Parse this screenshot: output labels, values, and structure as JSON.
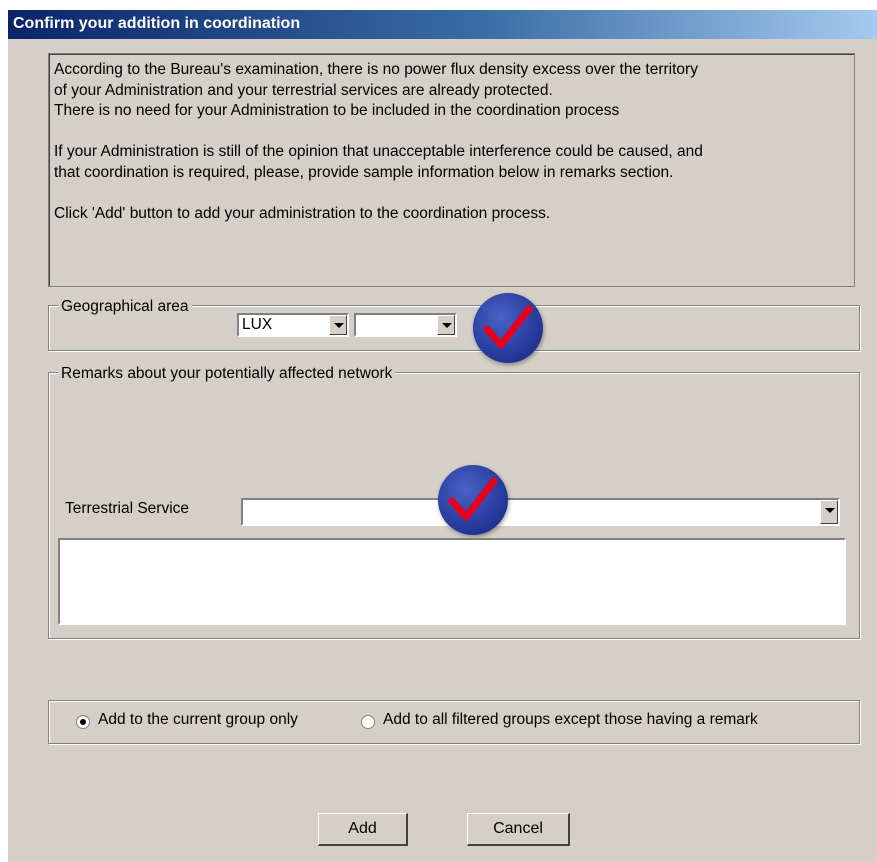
{
  "dialog": {
    "title": "Confirm your addition in coordination",
    "message": "According to the Bureau's examination, there is no power flux density excess over the territory\nof your Administration and your terrestrial services are already protected.\nThere is no need for your Administration to be included in the coordination process\n\nIf your Administration is still of the opinion that unacceptable interference could be caused, and\nthat coordination is required, please, provide sample information below in remarks section.\n\nClick 'Add' button to add your administration to the coordination process."
  },
  "geo": {
    "legend": "Geographical area",
    "country_value": "LUX",
    "sub_value": ""
  },
  "remarks": {
    "legend": "Remarks about your potentially affected network",
    "terrestrial_label": "Terrestrial Service",
    "terrestrial_value": "",
    "memo_value": ""
  },
  "scope": {
    "option_current": "Add to the current group only",
    "option_all": "Add to all filtered groups except those having a remark",
    "selected": "current"
  },
  "buttons": {
    "add": "Add",
    "cancel": "Cancel"
  },
  "annotations": {
    "badge_color": "#2a3ea0",
    "check_color": "#e8001c",
    "badge_icon": "red-checkmark-icon"
  }
}
